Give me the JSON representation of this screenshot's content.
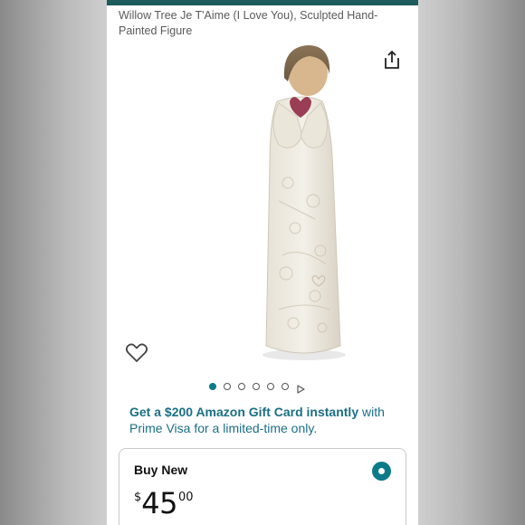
{
  "product": {
    "title": "Willow Tree Je T'Aime (I Love You), Sculpted Hand-Painted Figure"
  },
  "icons": {
    "share": "share-icon",
    "wishlist": "heart-outline-icon",
    "carousel_next": "play-triangle-icon"
  },
  "carousel": {
    "total_images": 6,
    "active_index": 0
  },
  "promo": {
    "bold_text": "Get a $200 Amazon Gift Card instantly",
    "rest_text": " with Prime Visa for a limited-time only."
  },
  "buy_box": {
    "label": "Buy New",
    "currency_symbol": "$",
    "price_whole": "45",
    "price_fraction": "00",
    "selected": true
  },
  "colors": {
    "accent": "#0b7b8a",
    "promo_text": "#1b6f84",
    "top_bar": "#1f5c5e"
  }
}
